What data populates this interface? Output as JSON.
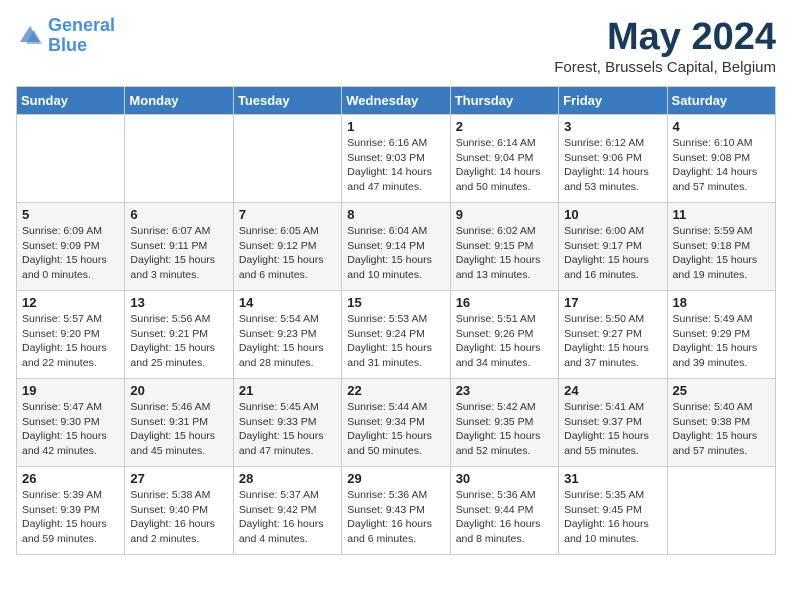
{
  "logo": {
    "line1": "General",
    "line2": "Blue"
  },
  "title": "May 2024",
  "location": "Forest, Brussels Capital, Belgium",
  "headers": [
    "Sunday",
    "Monday",
    "Tuesday",
    "Wednesday",
    "Thursday",
    "Friday",
    "Saturday"
  ],
  "weeks": [
    [
      {
        "day": "",
        "sunrise": "",
        "sunset": "",
        "daylight": ""
      },
      {
        "day": "",
        "sunrise": "",
        "sunset": "",
        "daylight": ""
      },
      {
        "day": "",
        "sunrise": "",
        "sunset": "",
        "daylight": ""
      },
      {
        "day": "1",
        "sunrise": "Sunrise: 6:16 AM",
        "sunset": "Sunset: 9:03 PM",
        "daylight": "Daylight: 14 hours and 47 minutes."
      },
      {
        "day": "2",
        "sunrise": "Sunrise: 6:14 AM",
        "sunset": "Sunset: 9:04 PM",
        "daylight": "Daylight: 14 hours and 50 minutes."
      },
      {
        "day": "3",
        "sunrise": "Sunrise: 6:12 AM",
        "sunset": "Sunset: 9:06 PM",
        "daylight": "Daylight: 14 hours and 53 minutes."
      },
      {
        "day": "4",
        "sunrise": "Sunrise: 6:10 AM",
        "sunset": "Sunset: 9:08 PM",
        "daylight": "Daylight: 14 hours and 57 minutes."
      }
    ],
    [
      {
        "day": "5",
        "sunrise": "Sunrise: 6:09 AM",
        "sunset": "Sunset: 9:09 PM",
        "daylight": "Daylight: 15 hours and 0 minutes."
      },
      {
        "day": "6",
        "sunrise": "Sunrise: 6:07 AM",
        "sunset": "Sunset: 9:11 PM",
        "daylight": "Daylight: 15 hours and 3 minutes."
      },
      {
        "day": "7",
        "sunrise": "Sunrise: 6:05 AM",
        "sunset": "Sunset: 9:12 PM",
        "daylight": "Daylight: 15 hours and 6 minutes."
      },
      {
        "day": "8",
        "sunrise": "Sunrise: 6:04 AM",
        "sunset": "Sunset: 9:14 PM",
        "daylight": "Daylight: 15 hours and 10 minutes."
      },
      {
        "day": "9",
        "sunrise": "Sunrise: 6:02 AM",
        "sunset": "Sunset: 9:15 PM",
        "daylight": "Daylight: 15 hours and 13 minutes."
      },
      {
        "day": "10",
        "sunrise": "Sunrise: 6:00 AM",
        "sunset": "Sunset: 9:17 PM",
        "daylight": "Daylight: 15 hours and 16 minutes."
      },
      {
        "day": "11",
        "sunrise": "Sunrise: 5:59 AM",
        "sunset": "Sunset: 9:18 PM",
        "daylight": "Daylight: 15 hours and 19 minutes."
      }
    ],
    [
      {
        "day": "12",
        "sunrise": "Sunrise: 5:57 AM",
        "sunset": "Sunset: 9:20 PM",
        "daylight": "Daylight: 15 hours and 22 minutes."
      },
      {
        "day": "13",
        "sunrise": "Sunrise: 5:56 AM",
        "sunset": "Sunset: 9:21 PM",
        "daylight": "Daylight: 15 hours and 25 minutes."
      },
      {
        "day": "14",
        "sunrise": "Sunrise: 5:54 AM",
        "sunset": "Sunset: 9:23 PM",
        "daylight": "Daylight: 15 hours and 28 minutes."
      },
      {
        "day": "15",
        "sunrise": "Sunrise: 5:53 AM",
        "sunset": "Sunset: 9:24 PM",
        "daylight": "Daylight: 15 hours and 31 minutes."
      },
      {
        "day": "16",
        "sunrise": "Sunrise: 5:51 AM",
        "sunset": "Sunset: 9:26 PM",
        "daylight": "Daylight: 15 hours and 34 minutes."
      },
      {
        "day": "17",
        "sunrise": "Sunrise: 5:50 AM",
        "sunset": "Sunset: 9:27 PM",
        "daylight": "Daylight: 15 hours and 37 minutes."
      },
      {
        "day": "18",
        "sunrise": "Sunrise: 5:49 AM",
        "sunset": "Sunset: 9:29 PM",
        "daylight": "Daylight: 15 hours and 39 minutes."
      }
    ],
    [
      {
        "day": "19",
        "sunrise": "Sunrise: 5:47 AM",
        "sunset": "Sunset: 9:30 PM",
        "daylight": "Daylight: 15 hours and 42 minutes."
      },
      {
        "day": "20",
        "sunrise": "Sunrise: 5:46 AM",
        "sunset": "Sunset: 9:31 PM",
        "daylight": "Daylight: 15 hours and 45 minutes."
      },
      {
        "day": "21",
        "sunrise": "Sunrise: 5:45 AM",
        "sunset": "Sunset: 9:33 PM",
        "daylight": "Daylight: 15 hours and 47 minutes."
      },
      {
        "day": "22",
        "sunrise": "Sunrise: 5:44 AM",
        "sunset": "Sunset: 9:34 PM",
        "daylight": "Daylight: 15 hours and 50 minutes."
      },
      {
        "day": "23",
        "sunrise": "Sunrise: 5:42 AM",
        "sunset": "Sunset: 9:35 PM",
        "daylight": "Daylight: 15 hours and 52 minutes."
      },
      {
        "day": "24",
        "sunrise": "Sunrise: 5:41 AM",
        "sunset": "Sunset: 9:37 PM",
        "daylight": "Daylight: 15 hours and 55 minutes."
      },
      {
        "day": "25",
        "sunrise": "Sunrise: 5:40 AM",
        "sunset": "Sunset: 9:38 PM",
        "daylight": "Daylight: 15 hours and 57 minutes."
      }
    ],
    [
      {
        "day": "26",
        "sunrise": "Sunrise: 5:39 AM",
        "sunset": "Sunset: 9:39 PM",
        "daylight": "Daylight: 15 hours and 59 minutes."
      },
      {
        "day": "27",
        "sunrise": "Sunrise: 5:38 AM",
        "sunset": "Sunset: 9:40 PM",
        "daylight": "Daylight: 16 hours and 2 minutes."
      },
      {
        "day": "28",
        "sunrise": "Sunrise: 5:37 AM",
        "sunset": "Sunset: 9:42 PM",
        "daylight": "Daylight: 16 hours and 4 minutes."
      },
      {
        "day": "29",
        "sunrise": "Sunrise: 5:36 AM",
        "sunset": "Sunset: 9:43 PM",
        "daylight": "Daylight: 16 hours and 6 minutes."
      },
      {
        "day": "30",
        "sunrise": "Sunrise: 5:36 AM",
        "sunset": "Sunset: 9:44 PM",
        "daylight": "Daylight: 16 hours and 8 minutes."
      },
      {
        "day": "31",
        "sunrise": "Sunrise: 5:35 AM",
        "sunset": "Sunset: 9:45 PM",
        "daylight": "Daylight: 16 hours and 10 minutes."
      },
      {
        "day": "",
        "sunrise": "",
        "sunset": "",
        "daylight": ""
      }
    ]
  ]
}
